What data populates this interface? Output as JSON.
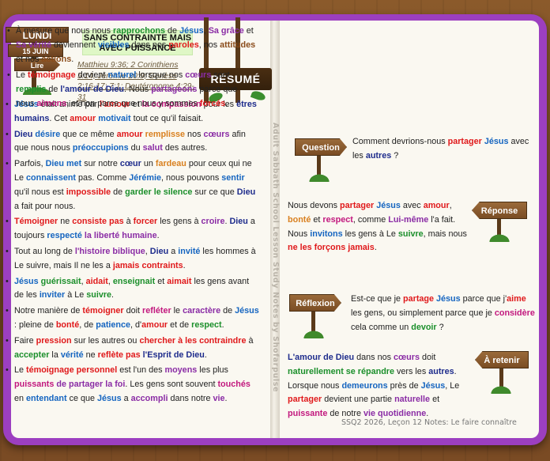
{
  "header": {
    "day": "LUNDI",
    "date": "15 JUIN",
    "lire": "Lire",
    "title_line1": "SANS CONTRAINTE MAIS",
    "title_line2": "AVEC PUISSANCE",
    "refs": "Matthieu 9:36; 2 Corinthiens 5:14; Jérémie 20:9; Genèse 2:16-17; 7:1; Deutéronome 4:29-31",
    "resume": "RÉSUMÉ"
  },
  "spine_text": "Adult Sabbath School Lesson Study Notes by Shofarpulse",
  "left_bullets": [
    [
      [
        "Jésus",
        "bl b"
      ],
      [
        " était animé par ",
        ""
      ],
      [
        "l'amour",
        "r b"
      ],
      [
        " et ",
        ""
      ],
      [
        "la compassion",
        "mg b"
      ],
      [
        " pour les ",
        ""
      ],
      [
        "êtres humains",
        "dk b"
      ],
      [
        ". Cet ",
        ""
      ],
      [
        "amour",
        "r b"
      ],
      [
        " ",
        ""
      ],
      [
        "motivait",
        "bl b"
      ],
      [
        " tout ce qu'il faisait.",
        ""
      ]
    ],
    [
      [
        "Dieu",
        "dk b"
      ],
      [
        " ",
        ""
      ],
      [
        "désire",
        "bl b"
      ],
      [
        " que ce même ",
        ""
      ],
      [
        "amour",
        "r b"
      ],
      [
        " ",
        ""
      ],
      [
        "remplisse",
        "o b"
      ],
      [
        " nos ",
        ""
      ],
      [
        "cœurs",
        "p b"
      ],
      [
        " afin que nous nous ",
        ""
      ],
      [
        "préoccupions",
        "bl b"
      ],
      [
        " du ",
        ""
      ],
      [
        "salut",
        "p b"
      ],
      [
        " des autres.",
        ""
      ]
    ],
    [
      [
        "Parfois, ",
        ""
      ],
      [
        "Dieu",
        "bl b"
      ],
      [
        " ",
        ""
      ],
      [
        "met",
        "bl b"
      ],
      [
        " sur notre ",
        ""
      ],
      [
        "cœur",
        "dk b"
      ],
      [
        " un ",
        ""
      ],
      [
        "fardeau",
        "o b"
      ],
      [
        " pour ceux qui ne Le ",
        ""
      ],
      [
        "connaissent",
        "bl b"
      ],
      [
        " pas. Comme ",
        ""
      ],
      [
        "Jérémie",
        "bl b"
      ],
      [
        ", nous pouvons ",
        ""
      ],
      [
        "sentir",
        "bl b"
      ],
      [
        " qu'il nous est ",
        ""
      ],
      [
        "impossible",
        "r b"
      ],
      [
        " de ",
        ""
      ],
      [
        "garder le silence",
        "g b"
      ],
      [
        " sur ce que ",
        ""
      ],
      [
        "Dieu",
        "dk b"
      ],
      [
        " a fait pour nous.",
        ""
      ]
    ],
    [
      [
        "Témoigner",
        "r b"
      ],
      [
        " ne ",
        ""
      ],
      [
        "consiste pas",
        "r b"
      ],
      [
        " à ",
        ""
      ],
      [
        "forcer",
        "r b"
      ],
      [
        " les gens à ",
        ""
      ],
      [
        "croire",
        "p b"
      ],
      [
        ". ",
        ""
      ],
      [
        "Dieu",
        "dk b"
      ],
      [
        " a toujours ",
        ""
      ],
      [
        "respecté",
        "bl b"
      ],
      [
        " ",
        ""
      ],
      [
        "la liberté humaine",
        "p b"
      ],
      [
        ".",
        ""
      ]
    ],
    [
      [
        "Tout au long de ",
        ""
      ],
      [
        "l'histoire biblique",
        "p b"
      ],
      [
        ", ",
        ""
      ],
      [
        "Dieu",
        "dk b"
      ],
      [
        " a ",
        ""
      ],
      [
        "invité",
        "bl b"
      ],
      [
        " les hommes à Le suivre, mais Il ne les a ",
        ""
      ],
      [
        "jamais contraints",
        "r b"
      ],
      [
        ".",
        ""
      ]
    ],
    [
      [
        "Jésus",
        "bl b"
      ],
      [
        " ",
        ""
      ],
      [
        "guérissait",
        "g b"
      ],
      [
        ", ",
        ""
      ],
      [
        "aidait",
        "r b"
      ],
      [
        ", ",
        ""
      ],
      [
        "enseignait",
        "g b"
      ],
      [
        " et ",
        ""
      ],
      [
        "aimait",
        "r b"
      ],
      [
        " les gens avant de les ",
        ""
      ],
      [
        "inviter",
        "bl b"
      ],
      [
        " à Le ",
        ""
      ],
      [
        "suivre",
        "g b"
      ],
      [
        ".",
        ""
      ]
    ],
    [
      [
        "Notre manière de ",
        ""
      ],
      [
        "témoigner",
        "r b"
      ],
      [
        " doit ",
        ""
      ],
      [
        "refléter",
        "mg b"
      ],
      [
        " le ",
        ""
      ],
      [
        "caractère",
        "p b"
      ],
      [
        " de ",
        ""
      ],
      [
        "Jésus",
        "bl b"
      ],
      [
        " : pleine de ",
        ""
      ],
      [
        "bonté",
        "r b"
      ],
      [
        ", de ",
        ""
      ],
      [
        "patience",
        "bl b"
      ],
      [
        ", d'",
        ""
      ],
      [
        "amour",
        "r b"
      ],
      [
        " et de ",
        ""
      ],
      [
        "respect",
        "g b"
      ],
      [
        ".",
        ""
      ]
    ],
    [
      [
        "Faire ",
        ""
      ],
      [
        "pression",
        "r b"
      ],
      [
        " sur les autres ou ",
        ""
      ],
      [
        "chercher à les contraindre",
        "r b"
      ],
      [
        " à ",
        ""
      ],
      [
        "accepter",
        "g b"
      ],
      [
        " la ",
        ""
      ],
      [
        "vérité",
        "bl b"
      ],
      [
        " ne ",
        ""
      ],
      [
        "reflète pas",
        "r b"
      ],
      [
        " ",
        ""
      ],
      [
        "l'Esprit de Dieu",
        "dk b"
      ],
      [
        ".",
        ""
      ]
    ],
    [
      [
        "Le ",
        ""
      ],
      [
        "témoignage personnel",
        "r b"
      ],
      [
        " est l'un des ",
        ""
      ],
      [
        "moyens",
        "p b"
      ],
      [
        " les plus ",
        ""
      ],
      [
        "puissants",
        "mg b"
      ],
      [
        " ",
        ""
      ],
      [
        "de partager la foi",
        "p b"
      ],
      [
        ". Les gens sont souvent ",
        ""
      ],
      [
        "touchés",
        "mg b"
      ],
      [
        " en ",
        ""
      ],
      [
        "entendant",
        "bl b"
      ],
      [
        " ce que ",
        ""
      ],
      [
        "Jésus",
        "bl b"
      ],
      [
        " a ",
        ""
      ],
      [
        "accompli",
        "p b"
      ],
      [
        " dans notre ",
        ""
      ],
      [
        "vie",
        "p b"
      ],
      [
        ".",
        ""
      ]
    ]
  ],
  "right_bullets": [
    [
      [
        "À mesure que nous nous ",
        ""
      ],
      [
        "rapprochons",
        "g b"
      ],
      [
        " de ",
        ""
      ],
      [
        "Jésus",
        "bl b"
      ],
      [
        ", ",
        ""
      ],
      [
        "Sa grâce",
        "p b"
      ],
      [
        " et ",
        ""
      ],
      [
        "Sa vérité",
        "p b"
      ],
      [
        " deviennent ",
        ""
      ],
      [
        "visibles",
        "bl b"
      ],
      [
        " dans nos ",
        ""
      ],
      [
        "paroles",
        "r b"
      ],
      [
        ", nos ",
        ""
      ],
      [
        "attitudes",
        "br b"
      ],
      [
        " et nos ",
        ""
      ],
      [
        "actions",
        "br b"
      ],
      [
        ".",
        ""
      ]
    ],
    [
      [
        "Le ",
        ""
      ],
      [
        "témoignage",
        "r b"
      ],
      [
        " devient ",
        ""
      ],
      [
        "naturel",
        "bl b"
      ],
      [
        " lorsque nos ",
        ""
      ],
      [
        "cœurs",
        "p b"
      ],
      [
        " sont ",
        ""
      ],
      [
        "remplis",
        "g b"
      ],
      [
        " de ",
        ""
      ],
      [
        "l'amour de Dieu",
        "dk b"
      ],
      [
        ". Nous ",
        ""
      ],
      [
        "partageons",
        "p b"
      ],
      [
        " parce que nous ",
        ""
      ],
      [
        "aimons",
        "mg b"
      ],
      [
        ", et non parce que nous y sommes ",
        ""
      ],
      [
        "forcés",
        "r b"
      ],
      [
        ".",
        ""
      ]
    ]
  ],
  "signs": {
    "question": "Question",
    "reponse": "Réponse",
    "reflexion": "Réflexion",
    "a_retenir": "À retenir"
  },
  "question": [
    [
      "Comment devrions-nous ",
      ""
    ],
    [
      "partager",
      "r b"
    ],
    [
      " ",
      ""
    ],
    [
      "Jésus",
      "bl b"
    ],
    [
      " avec les ",
      ""
    ],
    [
      "autres",
      "dk b"
    ],
    [
      " ?",
      ""
    ]
  ],
  "reponse": [
    [
      "Nous devons ",
      ""
    ],
    [
      "partager",
      "r b"
    ],
    [
      " ",
      ""
    ],
    [
      "Jésus",
      "bl b"
    ],
    [
      " avec ",
      ""
    ],
    [
      "amour",
      "r b"
    ],
    [
      ", ",
      ""
    ],
    [
      "bonté",
      "o b"
    ],
    [
      " et ",
      ""
    ],
    [
      "respect",
      "mg b"
    ],
    [
      ", comme ",
      ""
    ],
    [
      "Lui-même",
      "p b"
    ],
    [
      " l'a fait. Nous ",
      ""
    ],
    [
      "invitons",
      "bl b"
    ],
    [
      " les gens à Le ",
      ""
    ],
    [
      "suivre",
      "g b"
    ],
    [
      ", mais nous ",
      ""
    ],
    [
      "ne les forçons jamais",
      "r b"
    ],
    [
      ".",
      ""
    ]
  ],
  "reflexion": [
    [
      "Est-ce que je ",
      ""
    ],
    [
      "partage",
      "r b"
    ],
    [
      " ",
      ""
    ],
    [
      "Jésus",
      "bl b"
    ],
    [
      " parce que j'",
      ""
    ],
    [
      "aime",
      "r b"
    ],
    [
      " les gens, ou simplement parce que je ",
      ""
    ],
    [
      "considère",
      "mg b"
    ],
    [
      " cela comme un ",
      ""
    ],
    [
      "devoir",
      "g b"
    ],
    [
      " ?",
      ""
    ]
  ],
  "a_retenir": [
    [
      "L'amour de Dieu",
      "dk b"
    ],
    [
      " dans nos ",
      ""
    ],
    [
      "cœurs",
      "p b"
    ],
    [
      " doit ",
      ""
    ],
    [
      "naturellement se répandre",
      "g b"
    ],
    [
      " vers les ",
      ""
    ],
    [
      "autres",
      "dk b"
    ],
    [
      ". Lorsque nous ",
      ""
    ],
    [
      "demeurons",
      "bl b"
    ],
    [
      " près de ",
      ""
    ],
    [
      "Jésus",
      "bl b"
    ],
    [
      ", Le ",
      ""
    ],
    [
      "partager",
      "r b"
    ],
    [
      " devient une partie ",
      ""
    ],
    [
      "naturelle",
      "p b"
    ],
    [
      " et ",
      ""
    ],
    [
      "puissante",
      "mg b"
    ],
    [
      " de notre ",
      ""
    ],
    [
      "vie quotidienne",
      "p b"
    ],
    [
      ".",
      ""
    ]
  ],
  "footer": "SSQ2 2026, Leçon 12 Notes: Le faire connaître"
}
